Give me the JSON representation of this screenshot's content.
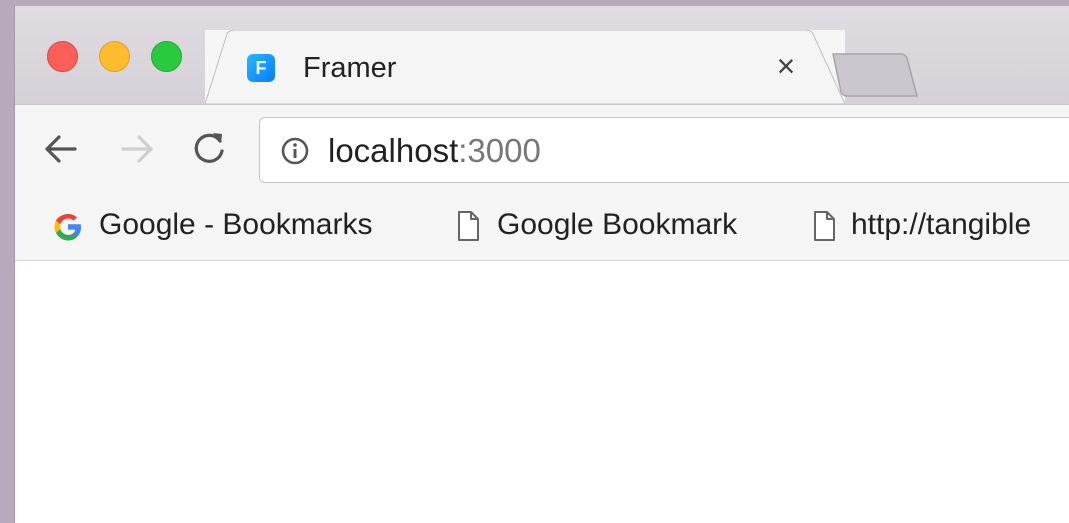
{
  "window": {
    "traffic_lights": [
      "close",
      "minimize",
      "maximize"
    ],
    "colors": {
      "close": "#fc5f57",
      "minimize": "#fdbc2e",
      "maximize": "#29c940"
    }
  },
  "tab": {
    "title": "Framer",
    "favicon_icon": "framer-logo-icon",
    "favicon_glyph": "F",
    "close_glyph": "×"
  },
  "toolbar": {
    "back_icon": "arrow-left-icon",
    "forward_icon": "arrow-right-icon",
    "reload_icon": "reload-icon",
    "omnibox": {
      "info_icon": "info-icon",
      "host": "localhost",
      "port": ":3000"
    }
  },
  "bookmarks": [
    {
      "label": "Google - Bookmarks",
      "icon": "google-g-icon"
    },
    {
      "label": "Google Bookmark",
      "icon": "page-icon"
    },
    {
      "label": "http://tangible",
      "icon": "page-icon"
    }
  ]
}
